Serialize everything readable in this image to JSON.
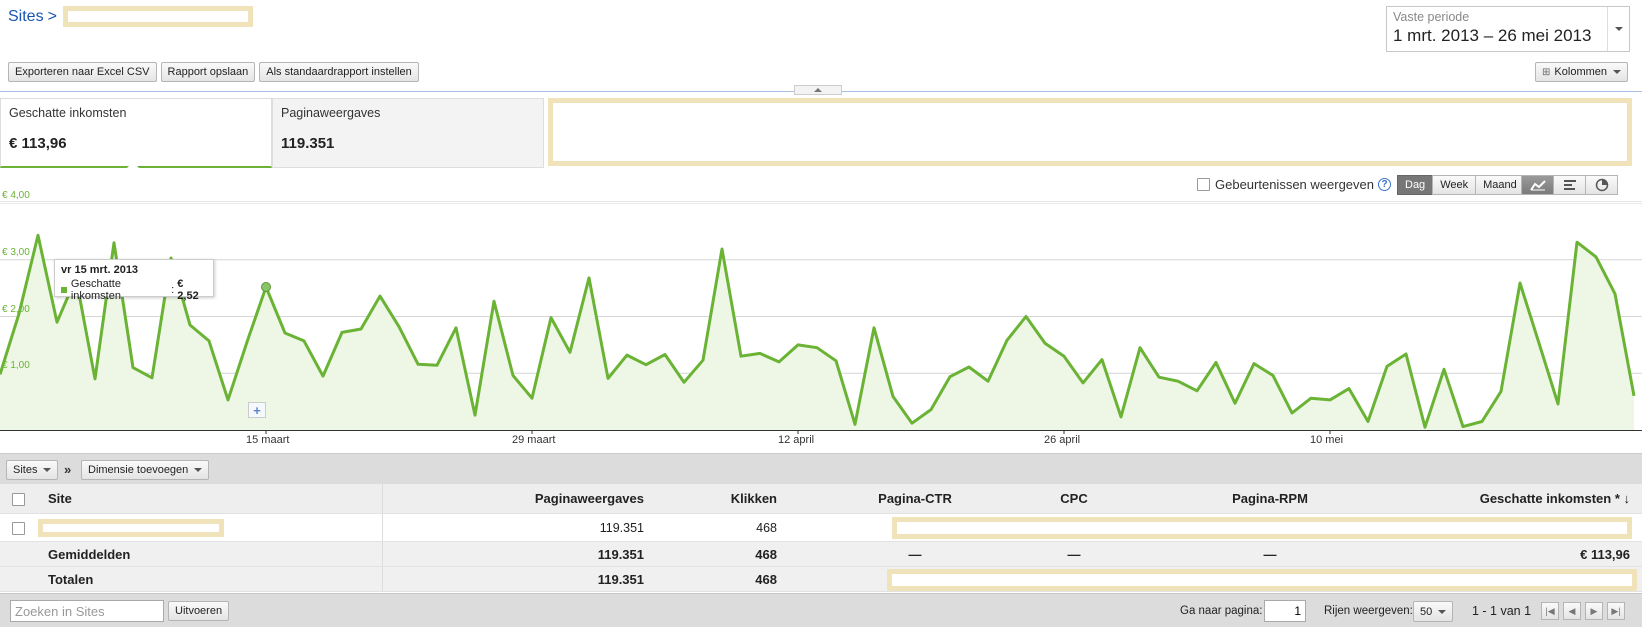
{
  "breadcrumb": {
    "root": "Sites",
    "separator": ">"
  },
  "period": {
    "label": "Vaste periode",
    "value": "1 mrt. 2013 – 26 mei 2013"
  },
  "toolbar": {
    "export": "Exporteren naar Excel CSV",
    "save": "Rapport opslaan",
    "default": "Als standaardrapport instellen",
    "columns": "Kolommen"
  },
  "metrics": [
    {
      "label": "Geschatte inkomsten",
      "value": "€ 113,96"
    },
    {
      "label": "Paginaweergaves",
      "value": "119.351"
    }
  ],
  "chart_controls": {
    "events": "Gebeurtenissen weergeven",
    "help": "?",
    "granularity": [
      "Dag",
      "Week",
      "Maand"
    ],
    "active_granularity": "Dag",
    "chart_types": [
      "line-chart-icon",
      "bar-chart-icon",
      "pie-chart-icon"
    ]
  },
  "chart_data": {
    "type": "area",
    "series": [
      {
        "name": "Geschatte inkomsten",
        "values": [
          0.98,
          2.05,
          3.43,
          1.9,
          2.68,
          0.9,
          3.3,
          1.1,
          0.92,
          3.03,
          1.85,
          1.57,
          0.53,
          1.55,
          2.52,
          1.71,
          1.57,
          0.95,
          1.72,
          1.78,
          2.36,
          1.82,
          1.16,
          1.14,
          1.8,
          0.26,
          2.27,
          0.96,
          0.56,
          1.98,
          1.37,
          2.68,
          0.91,
          1.32,
          1.15,
          1.33,
          0.84,
          1.23,
          3.19,
          1.3,
          1.35,
          1.2,
          1.5,
          1.45,
          1.22,
          0.1,
          1.8,
          0.59,
          0.12,
          0.36,
          0.94,
          1.11,
          0.86,
          1.58,
          2.0,
          1.53,
          1.3,
          0.83,
          1.24,
          0.23,
          1.45,
          0.93,
          0.86,
          0.69,
          1.19,
          0.47,
          1.17,
          0.96,
          0.3,
          0.56,
          0.53,
          0.73,
          0.15,
          1.12,
          1.34,
          0.05,
          1.07,
          0.06,
          0.15,
          0.68,
          2.59,
          1.53,
          0.46,
          3.31,
          3.05,
          2.4,
          0.6
        ]
      }
    ],
    "x_start": "2013-03-01",
    "x_end": "2013-05-26",
    "x_ticks": [
      "15 maart",
      "29 maart",
      "12 april",
      "26 april",
      "10 mei"
    ],
    "y_ticks": [
      "€ 1,00",
      "€ 2,00",
      "€ 3,00",
      "€ 4,00"
    ],
    "ylim": [
      0,
      4
    ],
    "grid": true,
    "color": "#6ab335",
    "tooltip": {
      "date": "vr 15 mrt. 2013",
      "series": "Geschatte inkomsten",
      "value": "€ 2,52"
    }
  },
  "dimension_bar": {
    "sites": "Sites",
    "arrow": "»",
    "add": "Dimensie toevoegen"
  },
  "table": {
    "headers": {
      "site": "Site",
      "pageviews": "Paginaweergaves",
      "clicks": "Klikken",
      "ctr": "Pagina-CTR",
      "cpc": "CPC",
      "rpm": "Pagina-RPM",
      "earnings": "Geschatte inkomsten * ↓"
    },
    "row1": {
      "pageviews": "119.351",
      "clicks": "468"
    },
    "averages": {
      "label": "Gemiddelden",
      "pageviews": "119.351",
      "clicks": "468",
      "ctr": "—",
      "cpc": "—",
      "rpm": "—",
      "earnings": "€ 113,96"
    },
    "totals": {
      "label": "Totalen",
      "pageviews": "119.351",
      "clicks": "468"
    }
  },
  "footer": {
    "search_placeholder": "Zoeken in Sites",
    "run": "Uitvoeren",
    "goto_label": "Ga naar pagina:",
    "goto_value": "1",
    "rows_label": "Rijen weergeven:",
    "rows_value": "50",
    "range": "1 - 1 van 1"
  }
}
